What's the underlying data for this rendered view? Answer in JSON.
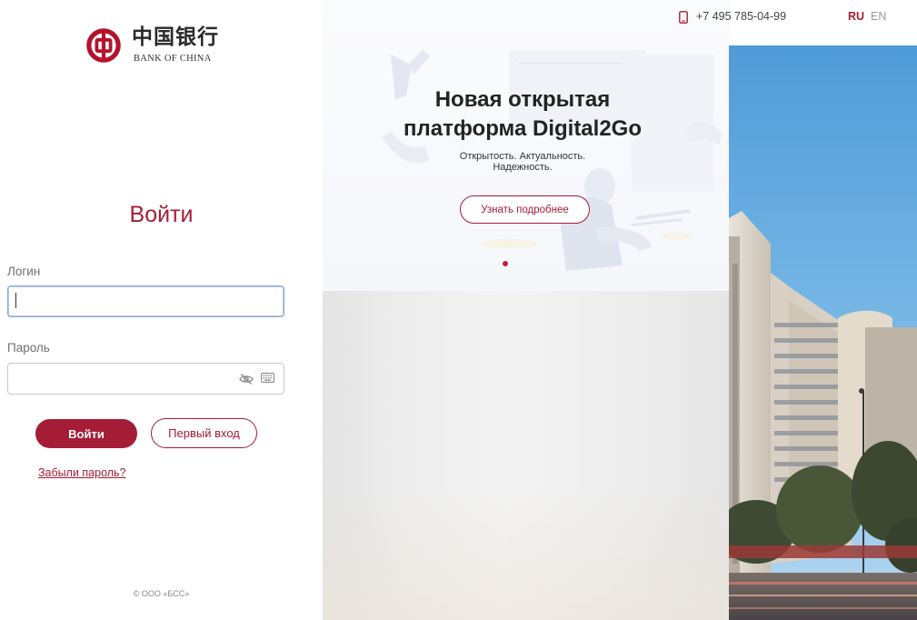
{
  "brand": {
    "name_cn": "中国银行",
    "name_en": "BANK OF CHINA",
    "color": "#a51c36",
    "logo_icon": "bank-of-china-logo-icon"
  },
  "header": {
    "phone_icon": "phone-icon",
    "phone": "+7 495 785-04-99",
    "languages": [
      {
        "code": "RU",
        "active": true
      },
      {
        "code": "EN",
        "active": false
      }
    ]
  },
  "login": {
    "title": "Войти",
    "login_label": "Логин",
    "login_value": "",
    "password_label": "Пароль",
    "password_value": "",
    "password_visibility_icon": "eye-slash-icon",
    "virtual_keyboard_icon": "keyboard-icon",
    "submit_label": "Войти",
    "first_login_label": "Первый вход",
    "forgot_label": "Забыли пароль?",
    "copyright": "© ООО «БСС»"
  },
  "promo": {
    "title": "Новая открытая платформа Digital2Go",
    "subtitle_line1": "Открытость. Актуальность.",
    "subtitle_line2": "Надежность.",
    "button_label": "Узнать подробнее",
    "slides_count": 1,
    "active_slide": 1
  }
}
